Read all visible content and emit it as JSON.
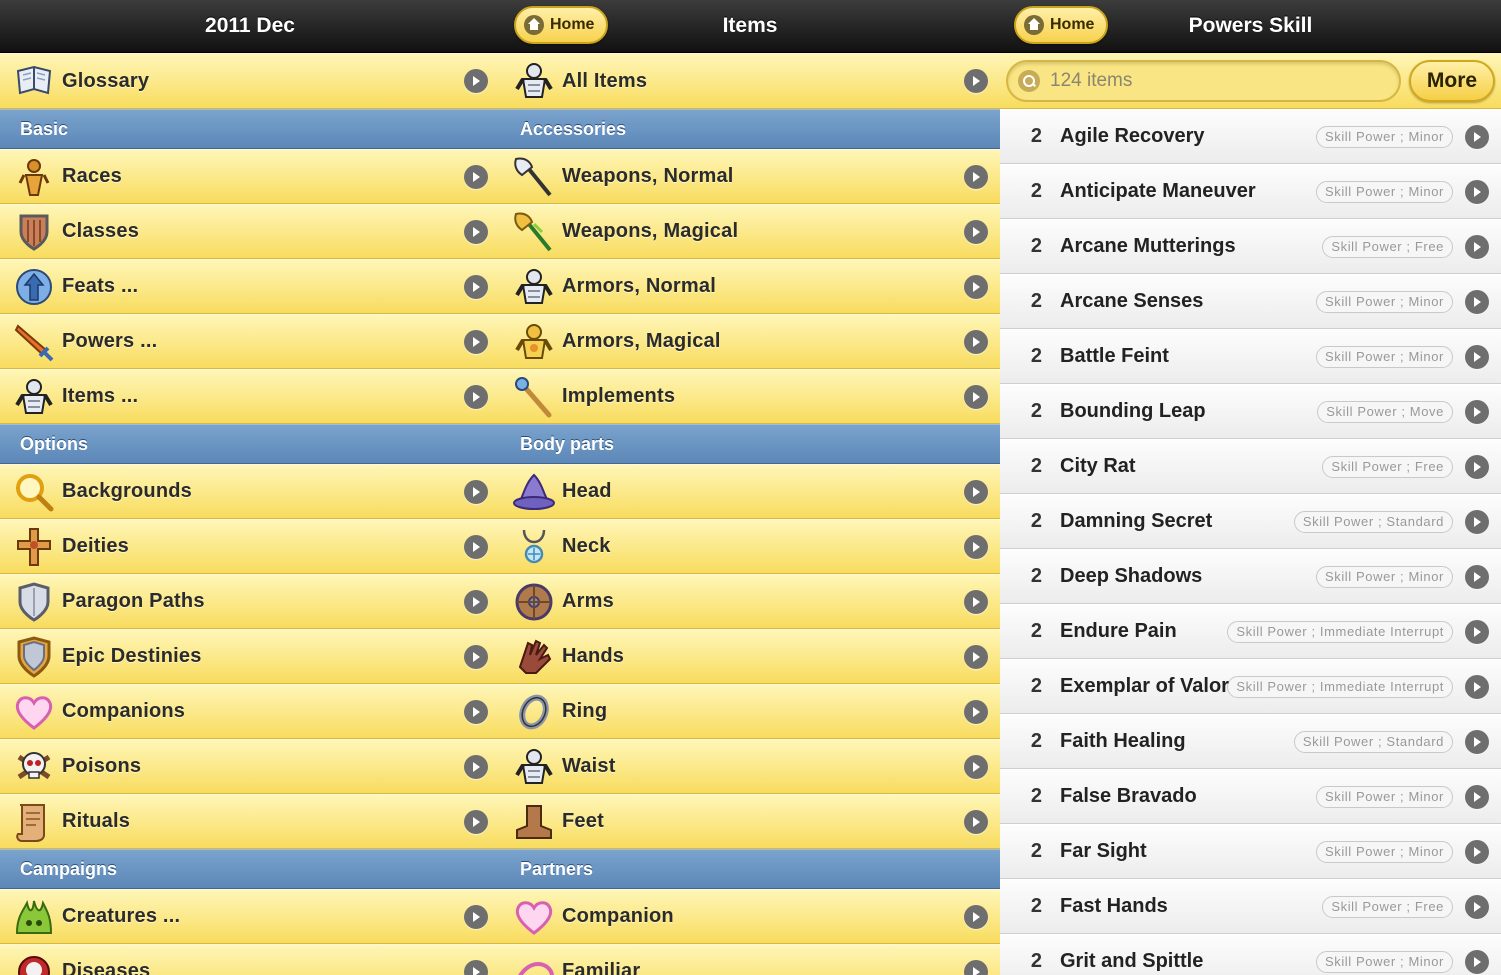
{
  "pane1": {
    "title": "2011 Dec",
    "top": {
      "label": "Glossary",
      "icon": "book-icon"
    },
    "sections": [
      {
        "header": "Basic",
        "items": [
          {
            "label": "Races",
            "icon": "races-icon"
          },
          {
            "label": "Classes",
            "icon": "shield-icon"
          },
          {
            "label": "Feats ...",
            "icon": "feats-icon"
          },
          {
            "label": "Powers ...",
            "icon": "sword-icon"
          },
          {
            "label": "Items ...",
            "icon": "armor-icon"
          }
        ]
      },
      {
        "header": "Options",
        "items": [
          {
            "label": "Backgrounds",
            "icon": "magnifier-icon"
          },
          {
            "label": "Deities",
            "icon": "cross-icon"
          },
          {
            "label": "Paragon Paths",
            "icon": "paragon-shield-icon"
          },
          {
            "label": "Epic Destinies",
            "icon": "epic-shield-icon"
          },
          {
            "label": "Companions",
            "icon": "heart-icon"
          },
          {
            "label": "Poisons",
            "icon": "skull-icon"
          },
          {
            "label": "Rituals",
            "icon": "scroll-icon"
          }
        ]
      },
      {
        "header": "Campaigns",
        "items": [
          {
            "label": "Creatures ...",
            "icon": "creature-icon"
          },
          {
            "label": "Diseases",
            "icon": "disease-icon"
          }
        ]
      }
    ]
  },
  "pane2": {
    "title": "Items",
    "home_label": "Home",
    "top": {
      "label": "All Items",
      "icon": "armor-icon"
    },
    "sections": [
      {
        "header": "Accessories",
        "items": [
          {
            "label": "Weapons, Normal",
            "icon": "axe-icon"
          },
          {
            "label": "Weapons, Magical",
            "icon": "magic-axe-icon"
          },
          {
            "label": "Armors, Normal",
            "icon": "armor-icon"
          },
          {
            "label": "Armors, Magical",
            "icon": "magic-armor-icon"
          },
          {
            "label": "Implements",
            "icon": "wand-icon"
          }
        ]
      },
      {
        "header": "Body parts",
        "items": [
          {
            "label": "Head",
            "icon": "hat-icon"
          },
          {
            "label": "Neck",
            "icon": "amulet-icon"
          },
          {
            "label": "Arms",
            "icon": "round-shield-icon"
          },
          {
            "label": "Hands",
            "icon": "glove-icon"
          },
          {
            "label": "Ring",
            "icon": "ring-icon"
          },
          {
            "label": "Waist",
            "icon": "armor-icon"
          },
          {
            "label": "Feet",
            "icon": "boot-icon"
          }
        ]
      },
      {
        "header": "Partners",
        "items": [
          {
            "label": "Companion",
            "icon": "heart-icon"
          },
          {
            "label": "Familiar",
            "icon": "familiar-icon"
          }
        ]
      }
    ]
  },
  "pane3": {
    "title": "Powers Skill",
    "home_label": "Home",
    "search_placeholder": "124 items",
    "more_label": "More",
    "powers": [
      {
        "level": "2",
        "name": "Agile Recovery",
        "tag": "Skill Power ; Minor"
      },
      {
        "level": "2",
        "name": "Anticipate Maneuver",
        "tag": "Skill Power ; Minor"
      },
      {
        "level": "2",
        "name": "Arcane Mutterings",
        "tag": "Skill Power ; Free"
      },
      {
        "level": "2",
        "name": "Arcane Senses",
        "tag": "Skill Power ; Minor"
      },
      {
        "level": "2",
        "name": "Battle Feint",
        "tag": "Skill Power ; Minor"
      },
      {
        "level": "2",
        "name": "Bounding Leap",
        "tag": "Skill Power ; Move"
      },
      {
        "level": "2",
        "name": "City Rat",
        "tag": "Skill Power ; Free"
      },
      {
        "level": "2",
        "name": "Damning Secret",
        "tag": "Skill Power ; Standard"
      },
      {
        "level": "2",
        "name": "Deep Shadows",
        "tag": "Skill Power ; Minor"
      },
      {
        "level": "2",
        "name": "Endure Pain",
        "tag": "Skill Power ; Immediate Interrupt"
      },
      {
        "level": "2",
        "name": "Exemplar of Valor",
        "tag": "Skill Power ; Immediate Interrupt"
      },
      {
        "level": "2",
        "name": "Faith Healing",
        "tag": "Skill Power ; Standard"
      },
      {
        "level": "2",
        "name": "False Bravado",
        "tag": "Skill Power ; Minor"
      },
      {
        "level": "2",
        "name": "Far Sight",
        "tag": "Skill Power ; Minor"
      },
      {
        "level": "2",
        "name": "Fast Hands",
        "tag": "Skill Power ; Free"
      },
      {
        "level": "2",
        "name": "Grit and Spittle",
        "tag": "Skill Power ; Minor"
      }
    ]
  }
}
